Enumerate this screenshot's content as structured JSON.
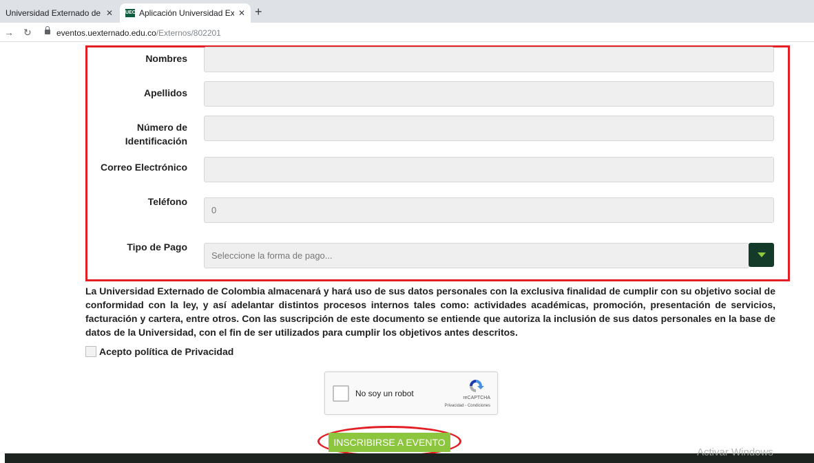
{
  "browser": {
    "tabs": [
      {
        "label": "Universidad Externado de Colo",
        "active": false,
        "close": "✕"
      },
      {
        "label": "Aplicación Universidad Externad",
        "active": true,
        "close": "✕",
        "favicon_text": "UEC"
      }
    ],
    "new_tab": "+",
    "url_domain": "eventos.uexternado.edu.co",
    "url_path": "/Externos/802201"
  },
  "form": {
    "fields": [
      {
        "label": "Nombres",
        "value": ""
      },
      {
        "label": "Apellidos",
        "value": ""
      },
      {
        "label_line1": "Número de",
        "label_line2": "Identificación",
        "value": ""
      },
      {
        "label": "Correo Electrónico",
        "value": ""
      },
      {
        "label": "Teléfono",
        "value": "0"
      },
      {
        "label": "Tipo de Pago",
        "placeholder": "Seleccione la forma de pago..."
      }
    ],
    "privacy_text": "La Universidad Externado de Colombia almacenará y hará uso de sus datos personales con la exclusiva finalidad de cumplir con su objetivo social de conformidad con la ley, y así adelantar distintos procesos internos tales como: actividades académicas, promoción, presentación de servicios, facturación y cartera, entre otros. Con las suscripción de este documento se entiende que autoriza la inclusión de sus datos personales en la base de datos de la Universidad, con el fin de ser utilizados para cumplir los objetivos antes descritos.",
    "privacy_checkbox_label": "Acepto política de Privacidad",
    "privacy_checked": false
  },
  "captcha": {
    "label": "No soy un robot",
    "brand": "reCAPTCHA",
    "links": "Privacidad - Condiciones"
  },
  "submit_label": "INSCRIBIRSE A EVENTO",
  "watermark": "Activar Windows",
  "colors": {
    "highlight": "#e31e24",
    "submit": "#8cc63f",
    "select_button": "#143a2a",
    "select_arrow": "#8ccb3c"
  }
}
